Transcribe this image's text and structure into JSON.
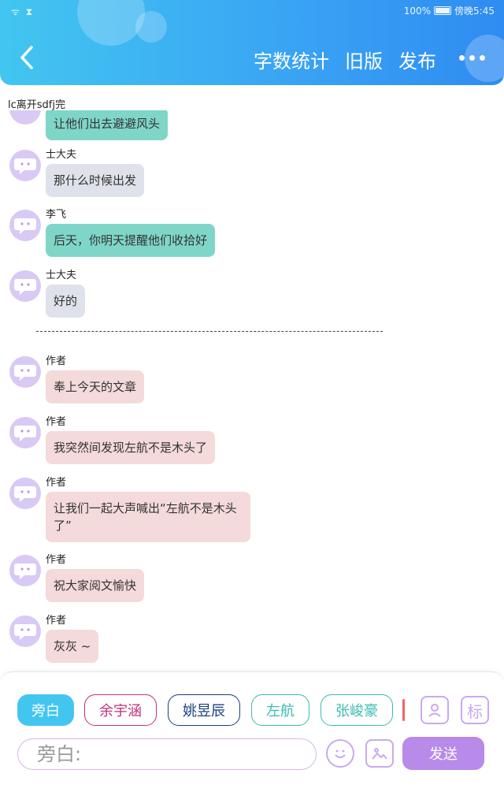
{
  "status": {
    "signal": "ᯤ ⧗",
    "battery": "100%",
    "time": "傍晚5:45"
  },
  "header": {
    "actions": [
      "字数统计",
      "旧版",
      "发布"
    ]
  },
  "doc_title": "lc离开sdfj完",
  "messages": [
    {
      "sender": "",
      "text": "让他们出去避避风头"
    },
    {
      "sender": "士大夫",
      "text": "那什么时候出发"
    },
    {
      "sender": "李飞",
      "text": "后天，你明天提醒他们收拾好"
    },
    {
      "sender": "士大夫",
      "text": "好的"
    },
    {
      "sender": "作者",
      "text": "奉上今天的文章"
    },
    {
      "sender": "作者",
      "text": "我突然间发现左航不是木头了"
    },
    {
      "sender": "作者",
      "text": "让我们一起大声喊出“左航不是木头了”"
    },
    {
      "sender": "作者",
      "text": "祝大家阅文愉快"
    },
    {
      "sender": "作者",
      "text": "灰灰 ~"
    }
  ],
  "divider": "------------------------------------------------------",
  "characters": [
    "旁白",
    "余宇涵",
    "姚昱辰",
    "左航",
    "张峻豪"
  ],
  "tools": {
    "avatar_icon": "person-card-icon",
    "tag_label": "标"
  },
  "input": {
    "placeholder": "旁白:"
  },
  "send_label": "发送",
  "colors": {
    "header_start": "#42c6f0",
    "header_end": "#2f8cf2",
    "send": "#b88ae9",
    "narrator_chip": "#42c6f0"
  }
}
